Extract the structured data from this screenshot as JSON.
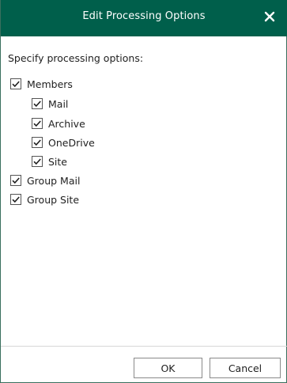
{
  "dialog": {
    "title": "Edit Processing Options",
    "close_icon": "close-icon",
    "accent_color": "#005f4b"
  },
  "prompt": "Specify processing options:",
  "options": [
    {
      "label": "Members",
      "checked": true
    },
    {
      "label": "Mail",
      "checked": true
    },
    {
      "label": "Archive",
      "checked": true
    },
    {
      "label": "OneDrive",
      "checked": true
    },
    {
      "label": "Site",
      "checked": true
    },
    {
      "label": "Group Mail",
      "checked": true
    },
    {
      "label": "Group Site",
      "checked": true
    }
  ],
  "buttons": {
    "ok": "OK",
    "cancel": "Cancel"
  }
}
